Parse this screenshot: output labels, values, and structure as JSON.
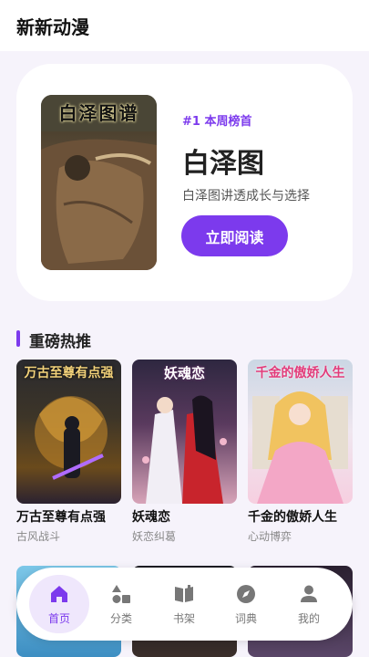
{
  "app": {
    "title": "新新动漫"
  },
  "hero": {
    "cover_text": "白泽图谱",
    "rank_label": "#1 本周榜首",
    "title": "白泽图",
    "description": "白泽图讲透成长与选择",
    "read_button": "立即阅读"
  },
  "section": {
    "title": "重磅热推"
  },
  "cards": [
    {
      "cover_text": "万古至尊有点强",
      "name": "万古至尊有点强",
      "tag": "古风战斗"
    },
    {
      "cover_text": "妖魂恋",
      "name": "妖魂恋",
      "tag": "妖恋纠葛"
    },
    {
      "cover_text": "千金的傲娇人生",
      "name": "千金的傲娇人生",
      "tag": "心动博弈"
    }
  ],
  "nav": {
    "items": [
      {
        "label": "首页",
        "icon": "home-icon",
        "active": true
      },
      {
        "label": "分类",
        "icon": "category-icon",
        "active": false
      },
      {
        "label": "书架",
        "icon": "bookshelf-icon",
        "active": false
      },
      {
        "label": "词典",
        "icon": "compass-icon",
        "active": false
      },
      {
        "label": "我的",
        "icon": "profile-icon",
        "active": false
      }
    ]
  },
  "colors": {
    "accent": "#7c3aed",
    "accent_light": "#efe7fc",
    "background": "#f6f3fb"
  }
}
